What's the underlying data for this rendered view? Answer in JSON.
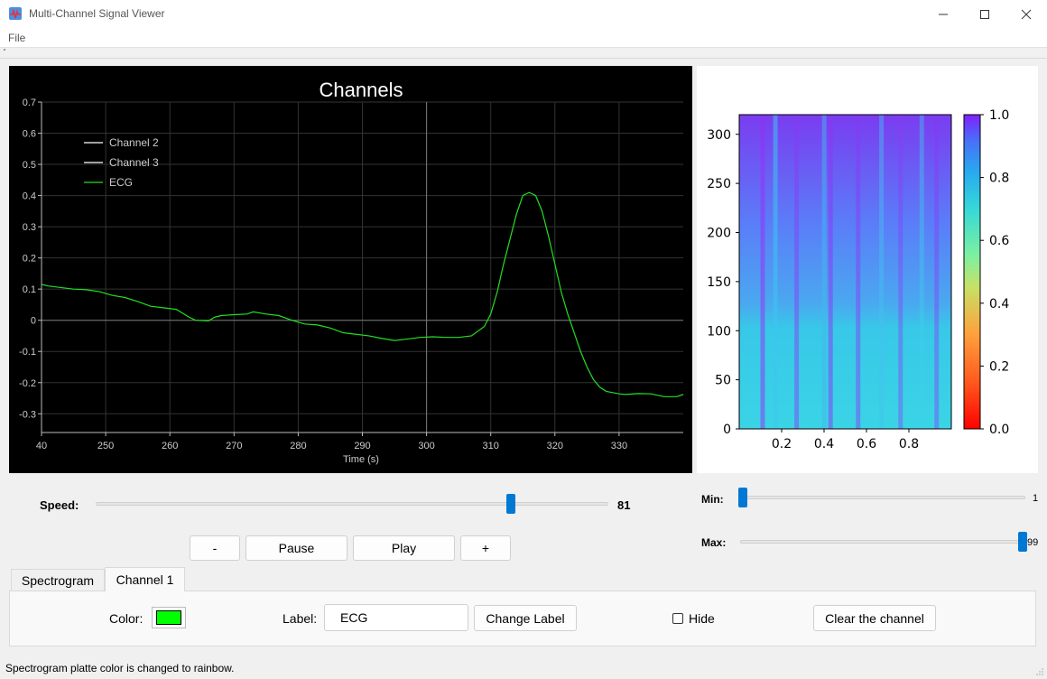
{
  "window": {
    "title": "Multi-Channel Signal Viewer",
    "minimize_icon": "minimize-icon",
    "maximize_icon": "maximize-icon",
    "close_icon": "close-icon"
  },
  "menu": {
    "file": "File"
  },
  "plot": {
    "title": "Channels",
    "xlabel": "Time (s)",
    "background": "#000000",
    "legend": [
      {
        "name": "Channel 2",
        "color": "#ffffff"
      },
      {
        "name": "Channel 3",
        "color": "#ffffff"
      },
      {
        "name": "ECG",
        "color": "#22e022"
      }
    ]
  },
  "chart_data": [
    {
      "type": "line",
      "title": "Channels",
      "xlabel": "Time (s)",
      "ylabel": "",
      "xlim": [
        240,
        340
      ],
      "ylim": [
        -0.36,
        0.7
      ],
      "x_ticks": [
        "40",
        "250",
        "260",
        "270",
        "280",
        "290",
        "300",
        "310",
        "320",
        "330"
      ],
      "y_ticks": [
        "0.7",
        "0.6",
        "0.5",
        "0.4",
        "0.3",
        "0.2",
        "0.1",
        "0",
        "-0.1",
        "-0.2",
        "-0.3"
      ],
      "grid": true,
      "legend_position": "top-left",
      "series": [
        {
          "name": "ECG",
          "color": "#22e022",
          "x": [
            240,
            241,
            243,
            245,
            247,
            249,
            251,
            253,
            255,
            257,
            259,
            261,
            263,
            264,
            266,
            267,
            268,
            270,
            272,
            273,
            275,
            277,
            279,
            281,
            283,
            285,
            287,
            289,
            291,
            293,
            295,
            297,
            299,
            301,
            303,
            305,
            307,
            309,
            310,
            311,
            312,
            313,
            314,
            315,
            316,
            317,
            318,
            319,
            320,
            321,
            322,
            323,
            324,
            325,
            326,
            327,
            328,
            329,
            330,
            331,
            333,
            335,
            337,
            339,
            340
          ],
          "y": [
            0.115,
            0.11,
            0.105,
            0.1,
            0.098,
            0.092,
            0.08,
            0.073,
            0.06,
            0.045,
            0.04,
            0.035,
            0.01,
            0.0,
            -0.002,
            0.01,
            0.015,
            0.018,
            0.02,
            0.027,
            0.02,
            0.015,
            0.0,
            -0.012,
            -0.015,
            -0.025,
            -0.04,
            -0.045,
            -0.05,
            -0.058,
            -0.065,
            -0.06,
            -0.055,
            -0.053,
            -0.055,
            -0.055,
            -0.05,
            -0.02,
            0.02,
            0.09,
            0.18,
            0.26,
            0.34,
            0.4,
            0.41,
            0.4,
            0.35,
            0.27,
            0.18,
            0.09,
            0.02,
            -0.04,
            -0.1,
            -0.15,
            -0.19,
            -0.215,
            -0.228,
            -0.232,
            -0.236,
            -0.238,
            -0.235,
            -0.236,
            -0.245,
            -0.245,
            -0.238
          ]
        }
      ]
    },
    {
      "type": "heatmap",
      "title": "",
      "xlabel": "",
      "ylabel": "",
      "xlim": [
        0,
        1
      ],
      "ylim": [
        0,
        320
      ],
      "x_ticks": [
        "0.2",
        "0.4",
        "0.6",
        "0.8"
      ],
      "y_ticks": [
        "0",
        "50",
        "100",
        "150",
        "200",
        "250",
        "300"
      ],
      "colorbar": {
        "min": 0.0,
        "max": 1.0,
        "ticks": [
          "0.0",
          "0.2",
          "0.4",
          "0.6",
          "0.8",
          "1.0"
        ],
        "colormap": "rainbow"
      }
    }
  ],
  "controls": {
    "speed_label": "Speed:",
    "speed_value": "81",
    "speed_fraction": 0.81,
    "min_label": "Min:",
    "min_value": "1",
    "min_fraction": 0.01,
    "max_label": "Max:",
    "max_value": "99",
    "max_fraction": 0.99,
    "minus_label": "-",
    "pause_label": "Pause",
    "play_label": "Play",
    "plus_label": "+"
  },
  "tabs": [
    {
      "label": "Spectrogram",
      "active": false
    },
    {
      "label": "Channel 1",
      "active": true
    }
  ],
  "channel": {
    "color_label": "Color:",
    "color_value": "#00ff00",
    "label_label": "Label:",
    "label_value": "ECG",
    "change_label_button": "Change Label",
    "hide_label": "Hide",
    "hide_checked": false,
    "clear_button": "Clear the channel"
  },
  "status_text": "Spectrogram platte color is changed to rainbow."
}
